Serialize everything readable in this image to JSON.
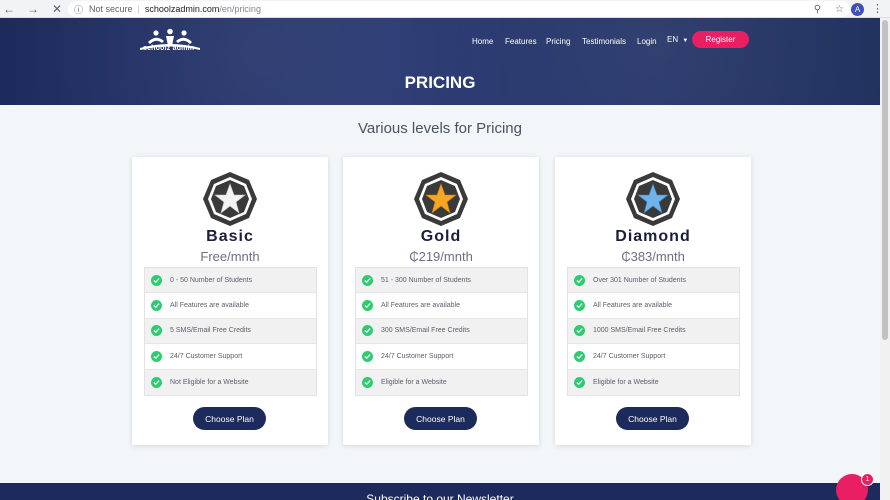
{
  "browser": {
    "security": "Not secure",
    "host": "schoolzadmin.com",
    "path": "/en/pricing",
    "profile_initial": "A"
  },
  "header": {
    "logo_text": "schoolz admin",
    "nav": [
      "Home",
      "Features",
      "Pricing",
      "Testimonials",
      "Login"
    ],
    "lang": "EN",
    "register": "Register",
    "page_title": "PRICING"
  },
  "subtitle": "Various levels for Pricing",
  "plans": [
    {
      "name": "Basic",
      "price": "Free/mnth",
      "star_color": "#f2f2f2",
      "features": [
        "0 - 50 Number of Students",
        "All Features are available",
        "5 SMS/Email Free Credits",
        "24/7 Customer Support",
        "Not Eligible for a Website"
      ],
      "button": "Choose Plan"
    },
    {
      "name": "Gold",
      "price": "₵219/mnth",
      "star_color": "#f5a623",
      "features": [
        "51 - 300 Number of Students",
        "All Features are available",
        "300 SMS/Email Free Credits",
        "24/7 Customer Support",
        "Eligible for a Website"
      ],
      "button": "Choose Plan"
    },
    {
      "name": "Diamond",
      "price": "₵383/mnth",
      "star_color": "#6fb3e8",
      "features": [
        "Over 301 Number of Students",
        "All Features are available",
        "1000 SMS/Email Free Credits",
        "24/7 Customer Support",
        "Eligible for a Website"
      ],
      "button": "Choose Plan"
    }
  ],
  "footer": {
    "text": "Subscribe to our Newsletter"
  },
  "chat": {
    "count": "1"
  },
  "colors": {
    "brand_navy": "#1d2b5c",
    "accent_pink": "#e91e63",
    "check_green": "#2ecc71"
  }
}
